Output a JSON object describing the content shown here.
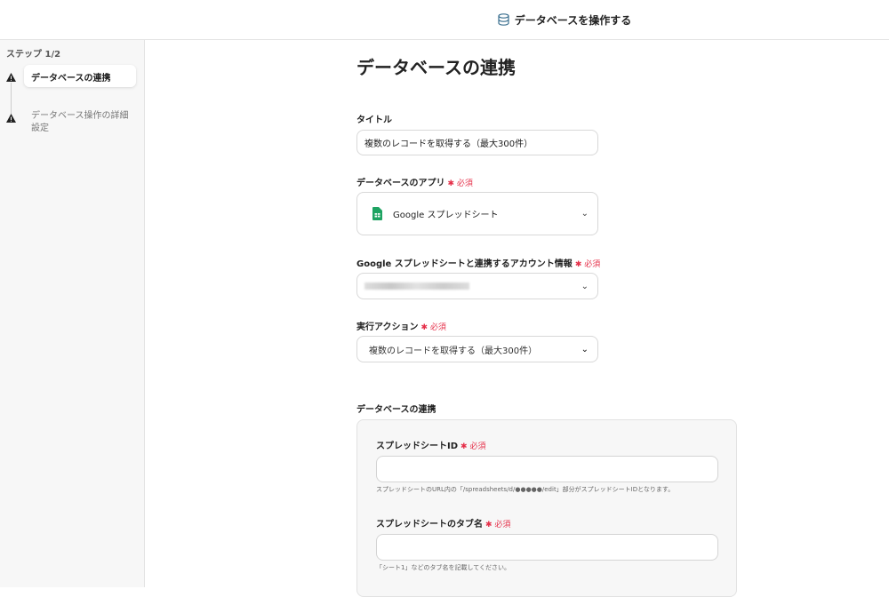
{
  "header": {
    "title": "データベースを操作する",
    "icon": "database-icon"
  },
  "sidebar": {
    "step_label": "ステップ 1/2",
    "items": [
      {
        "label": "データベースの連携",
        "status": "warning"
      },
      {
        "label": "データベース操作の詳細設定",
        "status": "warning"
      }
    ]
  },
  "main": {
    "title": "データベースの連携",
    "required": "必須",
    "title_field": {
      "label": "タイトル",
      "value": "複数のレコードを取得する（最大300件）"
    },
    "app_field": {
      "label": "データベースのアプリ",
      "value": "Google スプレッドシート"
    },
    "account_field": {
      "label": "Google スプレッドシートと連携するアカウント情報"
    },
    "action_field": {
      "label": "実行アクション",
      "value": "複数のレコードを取得する（最大300件）"
    },
    "section_label": "データベースの連携",
    "sheet_id": {
      "label": "スプレッドシートID",
      "value": "",
      "help": "スプレッドシートのURL内の「/spreadsheets/d/●●●●●/edit」部分がスプレッドシートIDとなります。"
    },
    "tab_name": {
      "label": "スプレッドシートのタブ名",
      "value": "",
      "help": "「シート1」などのタブ名を記載してください。"
    }
  }
}
